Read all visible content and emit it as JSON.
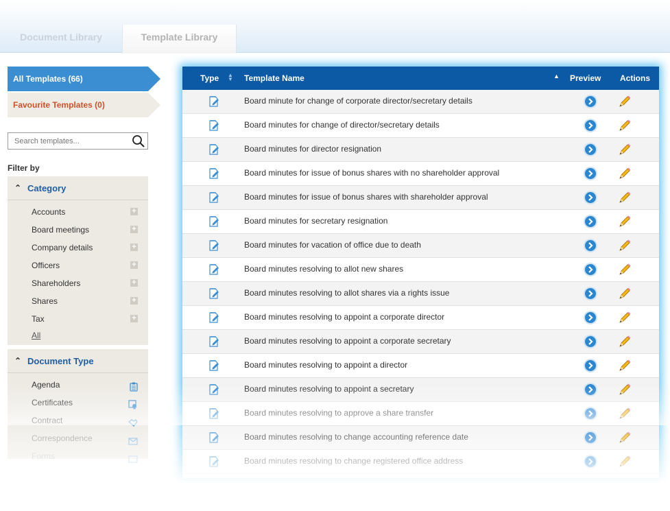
{
  "tabs": {
    "document_library": "Document Library",
    "template_library": "Template Library"
  },
  "sidebar": {
    "all_templates": "All Templates (66)",
    "favourite_templates": "Favourite Templates (0)",
    "search_placeholder": "Search templates...",
    "filter_by": "Filter by",
    "category": {
      "title": "Category",
      "items": [
        "Accounts",
        "Board meetings",
        "Company details",
        "Officers",
        "Shareholders",
        "Shares",
        "Tax"
      ],
      "all": "All"
    },
    "document_type": {
      "title": "Document Type",
      "items": [
        {
          "label": "Agenda",
          "icon": "clipboard-icon"
        },
        {
          "label": "Certificates",
          "icon": "certificate-icon"
        },
        {
          "label": "Contract",
          "icon": "handshake-icon"
        },
        {
          "label": "Correspondence",
          "icon": "envelope-icon"
        },
        {
          "label": "Forms",
          "icon": "form-icon"
        }
      ]
    }
  },
  "table": {
    "headers": {
      "type": "Type",
      "name": "Template Name",
      "preview": "Preview",
      "actions": "Actions"
    },
    "rows": [
      "Board minute for change of corporate director/secretary details",
      "Board minutes for change of director/secretary details",
      "Board minutes for director resignation",
      "Board minutes for issue of bonus shares with no shareholder approval",
      "Board minutes for issue of bonus shares with shareholder approval",
      "Board minutes for secretary resignation",
      "Board minutes for vacation of office due to death",
      "Board minutes resolving to allot new shares",
      "Board minutes resolving to allot shares via a rights issue",
      "Board minutes resolving to appoint a corporate director",
      "Board minutes resolving to appoint a corporate secretary",
      "Board minutes resolving to appoint a director",
      "Board minutes resolving to appoint a secretary",
      "Board minutes resolving to approve a share transfer",
      "Board minutes resolving to change accounting reference date",
      "Board minutes resolving to change registered office address"
    ]
  },
  "colors": {
    "header_blue": "#0c5aa6",
    "active_nav": "#3c8ed2",
    "favourite_text": "#d1502a",
    "panel_bg": "#edeae4",
    "glow": "#69c6f3"
  }
}
